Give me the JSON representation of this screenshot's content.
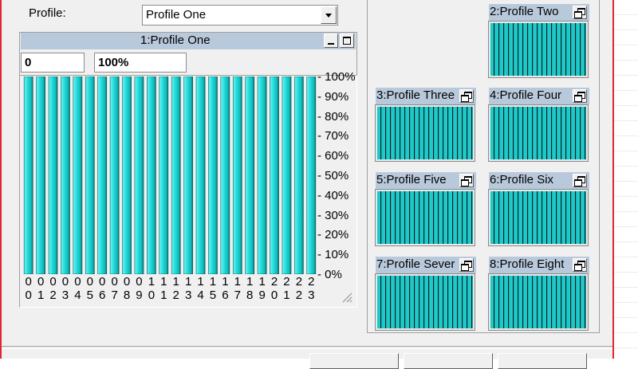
{
  "profile": {
    "label": "Profile:",
    "selected": "Profile One"
  },
  "main_panel": {
    "title": "1:Profile One",
    "min_value": "0",
    "max_value": "100%",
    "y_ticks": [
      "100%",
      "90%",
      "80%",
      "70%",
      "60%",
      "50%",
      "40%",
      "30%",
      "20%",
      "10%",
      "0%"
    ],
    "x_ticks_top": [
      "0",
      "0",
      "0",
      "0",
      "0",
      "0",
      "0",
      "0",
      "0",
      "0",
      "1",
      "1",
      "1",
      "1",
      "1",
      "1",
      "1",
      "1",
      "1",
      "1",
      "2",
      "2",
      "2",
      "2"
    ],
    "x_ticks_bottom": [
      "0",
      "1",
      "2",
      "3",
      "4",
      "5",
      "6",
      "7",
      "8",
      "9",
      "0",
      "1",
      "2",
      "3",
      "4",
      "5",
      "6",
      "7",
      "8",
      "9",
      "0",
      "1",
      "2",
      "3"
    ]
  },
  "chart_data": {
    "type": "bar",
    "categories": [
      "00",
      "01",
      "02",
      "03",
      "04",
      "05",
      "06",
      "07",
      "08",
      "09",
      "10",
      "11",
      "12",
      "13",
      "14",
      "15",
      "16",
      "17",
      "18",
      "19",
      "20",
      "21",
      "22",
      "23"
    ],
    "values": [
      100,
      100,
      100,
      100,
      100,
      100,
      100,
      100,
      100,
      100,
      100,
      100,
      100,
      100,
      100,
      100,
      100,
      100,
      100,
      100,
      100,
      100,
      100,
      100
    ],
    "ylim": [
      0,
      100
    ],
    "title": "1:Profile One"
  },
  "thumbnails": [
    {
      "title": "2:Profile Two"
    },
    {
      "title": "3:Profile Three"
    },
    {
      "title": "4:Profile Four"
    },
    {
      "title": "5:Profile Five"
    },
    {
      "title": "6:Profile Six"
    },
    {
      "title": "7:Profile Sever"
    },
    {
      "title": "8:Profile Eight"
    }
  ],
  "colors": {
    "bar": "#1ed9d9",
    "titlebar": "#b9c9dc",
    "border_accent": "#e0262f"
  }
}
